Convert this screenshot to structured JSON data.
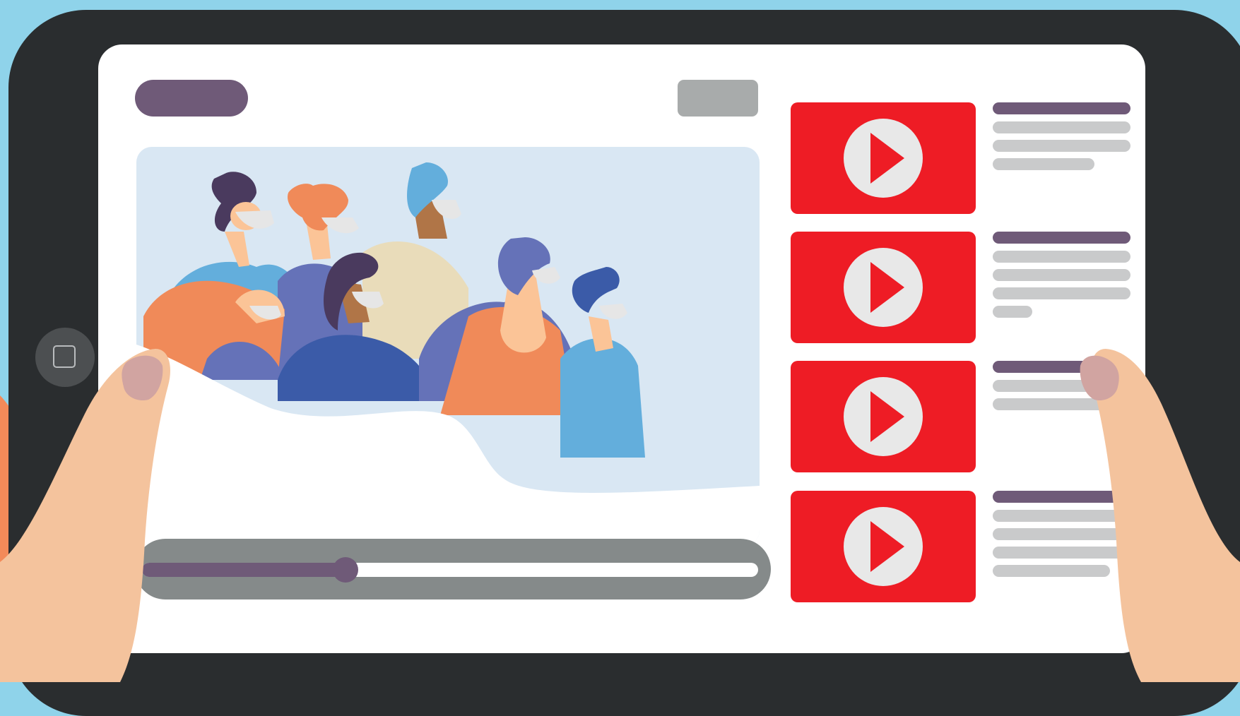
{
  "colors": {
    "sky": "#8fd3ea",
    "tablet_frame": "#2a2d2f",
    "screen": "#ffffff",
    "accent_purple": "#6f5a78",
    "button_gray": "#a8abab",
    "video_bg": "#d9e7f3",
    "thumbnail_red": "#ee1c25",
    "play_circle": "#e8e8e8",
    "text_placeholder": "#c9cacb",
    "skin": "#f4c39d"
  },
  "player": {
    "progress": 0.33
  },
  "icons": {
    "home": "square-icon",
    "play": "play-icon"
  },
  "playlist": [
    {
      "name": "video-1"
    },
    {
      "name": "video-2"
    },
    {
      "name": "video-3"
    },
    {
      "name": "video-4"
    }
  ]
}
